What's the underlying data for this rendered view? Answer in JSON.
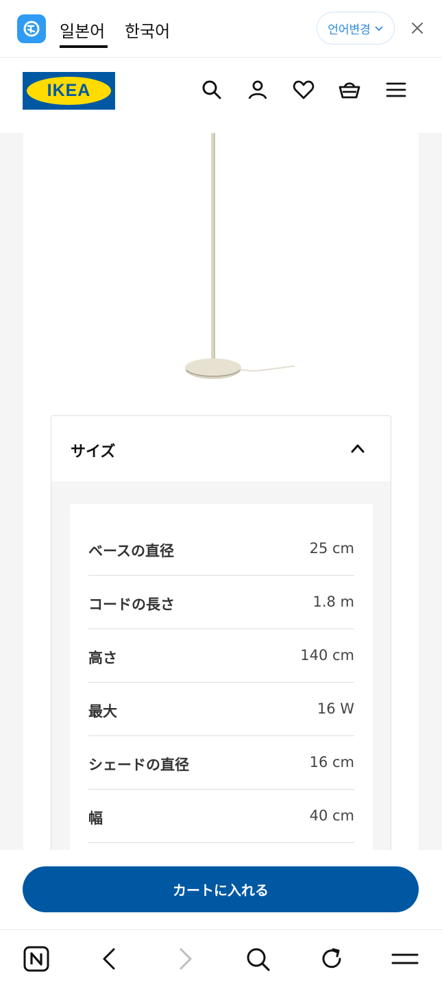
{
  "translate_bar": {
    "tabs": [
      "일본어",
      "한국어"
    ],
    "active_tab": "일본어",
    "change_language_label": "언어변경"
  },
  "header": {
    "logo_text": "IKEA",
    "icons": [
      "search-icon",
      "account-icon",
      "heart-icon",
      "cart-icon",
      "menu-icon"
    ]
  },
  "product": {
    "image": "floor-lamp-base-beige"
  },
  "size_section": {
    "title": "サイズ",
    "rows": [
      {
        "label": "ベースの直径",
        "value": "25 cm"
      },
      {
        "label": "コードの長さ",
        "value": "1.8 m"
      },
      {
        "label": "高さ",
        "value": "140 cm"
      },
      {
        "label": "最大",
        "value": "16 W"
      },
      {
        "label": "シェードの直径",
        "value": "16 cm"
      },
      {
        "label": "幅",
        "value": "40 cm"
      }
    ]
  },
  "cart": {
    "button_label": "カートに入れる"
  },
  "browser_nav": {
    "icons": [
      "naver-icon",
      "back-icon",
      "forward-icon",
      "search-icon",
      "reload-icon",
      "menu-icon"
    ]
  },
  "colors": {
    "ikea_blue": "#0058a3",
    "ikea_yellow": "#ffdb00",
    "translate_accent": "#2a8ae0"
  }
}
